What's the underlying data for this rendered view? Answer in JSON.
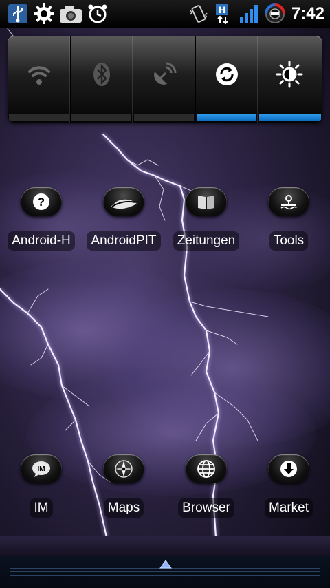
{
  "status_bar": {
    "left_icons": [
      "usb-icon",
      "settings-icon",
      "camera-icon",
      "alarm-clock-icon"
    ],
    "right_icons": [
      "vibrate-icon",
      "network-h-data-icon",
      "signal-icon",
      "status-ring-icon"
    ],
    "time": "7:42"
  },
  "quick_settings": {
    "toggles": [
      {
        "name": "wifi",
        "icon": "wifi-icon",
        "on": false
      },
      {
        "name": "bluetooth",
        "icon": "bluetooth-icon",
        "on": false
      },
      {
        "name": "gps",
        "icon": "gps-icon",
        "on": false
      },
      {
        "name": "sync",
        "icon": "sync-icon",
        "on": true
      },
      {
        "name": "brightness",
        "icon": "brightness-icon",
        "on": true
      }
    ]
  },
  "apps": {
    "row1": [
      {
        "label": "Android-H",
        "icon": "help-icon"
      },
      {
        "label": "AndroidPIT",
        "icon": "androidpit-icon"
      },
      {
        "label": "Zeitungen",
        "icon": "newspaper-icon"
      },
      {
        "label": "Tools",
        "icon": "tools-icon"
      }
    ],
    "row2": [
      {
        "label": "IM",
        "icon": "im-icon"
      },
      {
        "label": "Maps",
        "icon": "compass-icon"
      },
      {
        "label": "Browser",
        "icon": "globe-icon"
      },
      {
        "label": "Market",
        "icon": "download-icon"
      }
    ]
  },
  "colors": {
    "accent": "#1a8ae0",
    "wallpaper": "#2e2546"
  }
}
